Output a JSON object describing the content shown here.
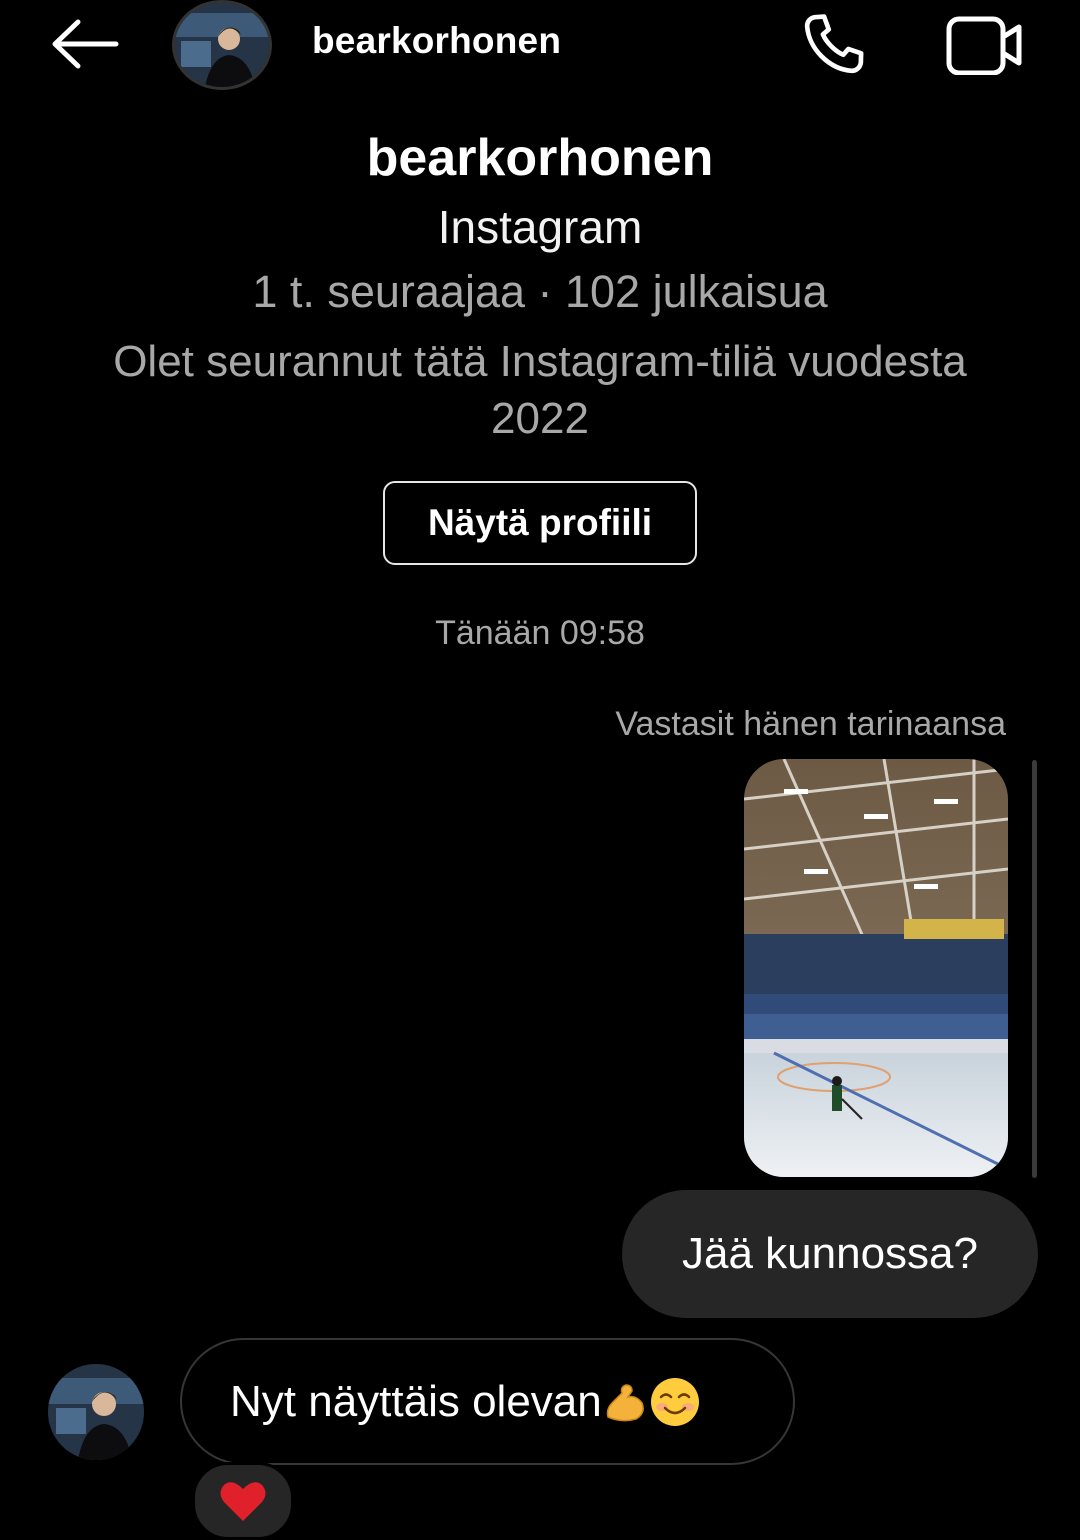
{
  "header": {
    "back_icon": "arrow-left-icon",
    "username": "bearkorhonen",
    "call_icon": "phone-icon",
    "video_icon": "video-camera-icon"
  },
  "profile": {
    "name": "bearkorhonen",
    "platform": "Instagram",
    "stats": "1 t. seuraajaa · 102 julkaisua",
    "follow_note": "Olet seurannut tätä Instagram-tiliä vuodesta 2022",
    "view_profile_label": "Näytä profiili"
  },
  "conversation": {
    "timestamp": "Tänään 09:58",
    "story_reply_note": "Vastasit hänen tarinaansa",
    "sent_message": "Jää kunnossa?",
    "received_message": "Nyt näyttäis olevan",
    "received_emojis": [
      "flexed-biceps-icon",
      "smiling-face-icon"
    ],
    "reaction": "heart-icon"
  },
  "colors": {
    "background": "#000000",
    "bubble": "#262626",
    "secondary_text": "#a8a8a8",
    "reaction_heart": "#e0202a"
  }
}
